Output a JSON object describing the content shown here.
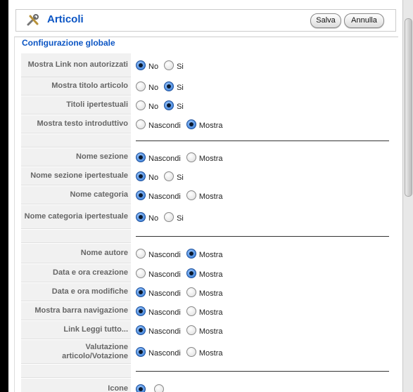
{
  "header": {
    "title": "Articoli",
    "save_label": "Salva",
    "cancel_label": "Annulla"
  },
  "panel": {
    "legend": "Configurazione globale"
  },
  "rows": [
    {
      "label": "Mostra Link non autorizzati",
      "options": [
        "No",
        "Si"
      ],
      "selected": 0
    },
    {
      "label": "Mostra titolo articolo",
      "options": [
        "No",
        "Si"
      ],
      "selected": 1
    },
    {
      "label": "Titoli ipertestuali",
      "options": [
        "No",
        "Si"
      ],
      "selected": 1
    },
    {
      "label": "Mostra testo introduttivo",
      "options": [
        "Nascondi",
        "Mostra"
      ],
      "selected": 1
    },
    {
      "label": "Nome sezione",
      "options": [
        "Nascondi",
        "Mostra"
      ],
      "selected": 0
    },
    {
      "label": "Nome sezione ipertestuale",
      "options": [
        "No",
        "Si"
      ],
      "selected": 0
    },
    {
      "label": "Nome categoria",
      "options": [
        "Nascondi",
        "Mostra"
      ],
      "selected": 0
    },
    {
      "label": "Nome categoria ipertestuale",
      "options": [
        "No",
        "Si"
      ],
      "selected": 0
    },
    {
      "label": "Nome autore",
      "options": [
        "Nascondi",
        "Mostra"
      ],
      "selected": 1
    },
    {
      "label": "Data e ora creazione",
      "options": [
        "Nascondi",
        "Mostra"
      ],
      "selected": 1
    },
    {
      "label": "Data e ora modifiche",
      "options": [
        "Nascondi",
        "Mostra"
      ],
      "selected": 0
    },
    {
      "label": "Mostra barra navigazione",
      "options": [
        "Nascondi",
        "Mostra"
      ],
      "selected": 0
    },
    {
      "label": "Link Leggi tutto...",
      "options": [
        "Nascondi",
        "Mostra"
      ],
      "selected": 0
    },
    {
      "label": "Valutazione articolo/Votazione",
      "options": [
        "Nascondi",
        "Mostra"
      ],
      "selected": 0
    },
    {
      "label": "Icone",
      "options": [
        "",
        ""
      ],
      "selected": 0
    }
  ]
}
